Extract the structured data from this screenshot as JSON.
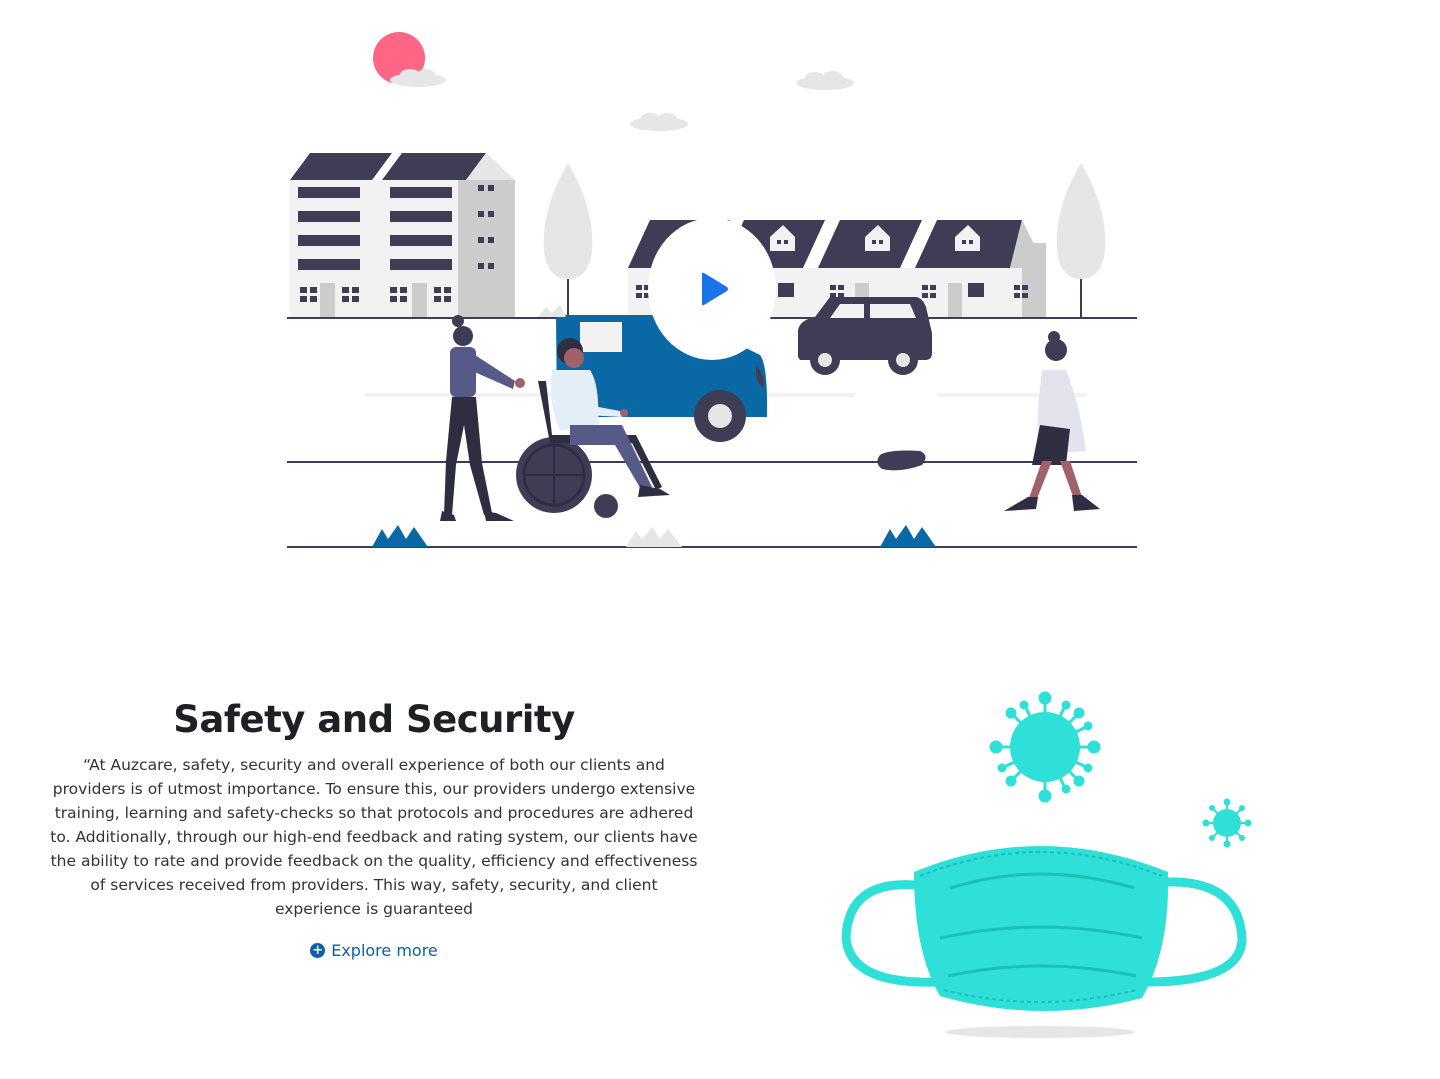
{
  "hero": {
    "play_icon": "play-icon",
    "colors": {
      "dark": "#3f3d56",
      "blue": "#0a68a4",
      "sun": "#ff6584",
      "light_gray": "#e6e6e6",
      "play": "#1a73e8"
    }
  },
  "safety": {
    "title": "Safety and Security",
    "body": "“At Auzcare, safety, security and overall experience of both our clients and providers is of utmost importance. To ensure this, our providers undergo extensive training, learning and safety-checks so that protocols and procedures are adhered to. Additionally, through our high-end feedback and rating system, our clients have the ability to rate and provide feedback on the quality, efficiency and effectiveness of services received from providers. This way, safety, security, and client experience is guaranteed",
    "explore_label": "Explore more",
    "explore_icon": "plus-circle-icon",
    "link_color": "#0d5fa7"
  },
  "mask": {
    "color": "#2fe0d8",
    "virus_icon": "virus-icon"
  }
}
